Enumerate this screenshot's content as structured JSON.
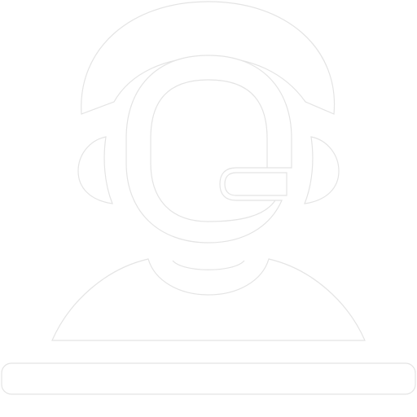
{
  "icon": {
    "name": "customer-support-agent-icon",
    "parts": [
      "headband-icon",
      "earcup-left-icon",
      "earcup-right-icon",
      "head-icon",
      "microphone-icon",
      "shoulders-icon",
      "desk-icon"
    ]
  },
  "colors": {
    "background": "#ffffff",
    "icon_fill": "#ffffff",
    "icon_outline": "#e4e4e4"
  }
}
